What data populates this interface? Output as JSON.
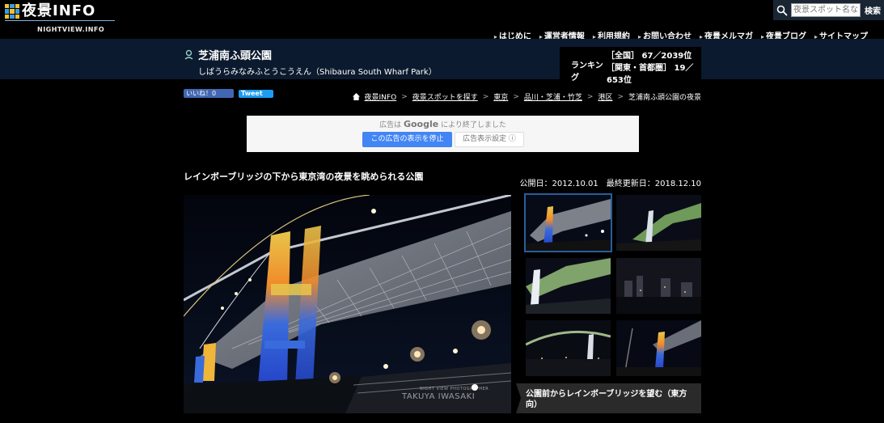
{
  "header": {
    "logo_text": "夜景INFO",
    "logo_sub": "NIGHTVIEW.INFO",
    "search": {
      "placeholder": "夜景スポット名な",
      "button_label": "検索"
    },
    "nav": [
      "はじめに",
      "運営者情報",
      "利用規約",
      "お問い合わせ",
      "夜景メルマガ",
      "夜景ブログ",
      "サイトマップ"
    ]
  },
  "spot": {
    "title": "芝浦南ふ頭公園",
    "reading": "しばうらみなみふとうこうえん（Shibaura South Wharf Park）"
  },
  "ranking": {
    "label": "ランキング",
    "national": "［全国］ 67／2039位",
    "regional": "［関東・首都圏］ 19／653位"
  },
  "social": {
    "like_label": "いいね！0",
    "tweet_label": "Tweet"
  },
  "breadcrumb": {
    "items": [
      "夜景INFO",
      "夜景スポットを探す",
      "東京",
      "品川・芝浦・竹芝",
      "港区"
    ],
    "current": "芝浦南ふ頭公園の夜景",
    "separator": ">"
  },
  "ad": {
    "prefix": "広告は",
    "brand": "Google",
    "suffix": "により終了しました",
    "stop_label": "この広告の表示を停止",
    "settings_label": "広告表示設定 ⓘ"
  },
  "article": {
    "title": "レインボーブリッジの下から東京湾の夜景を眺められる公園",
    "dates": "公開日：2012.10.01　最終更新日：2018.12.10"
  },
  "photo": {
    "watermark_small": "NIGHT VIEW PHOTOGRAPHER",
    "watermark": "TAKUYA IWASAKI"
  },
  "caption": "公園前からレインボーブリッジを望む（東方向）",
  "colors": {
    "header_bg": "#000000",
    "title_bar_bg": "#0b1a2e",
    "accent_blue": "#4285f4"
  }
}
